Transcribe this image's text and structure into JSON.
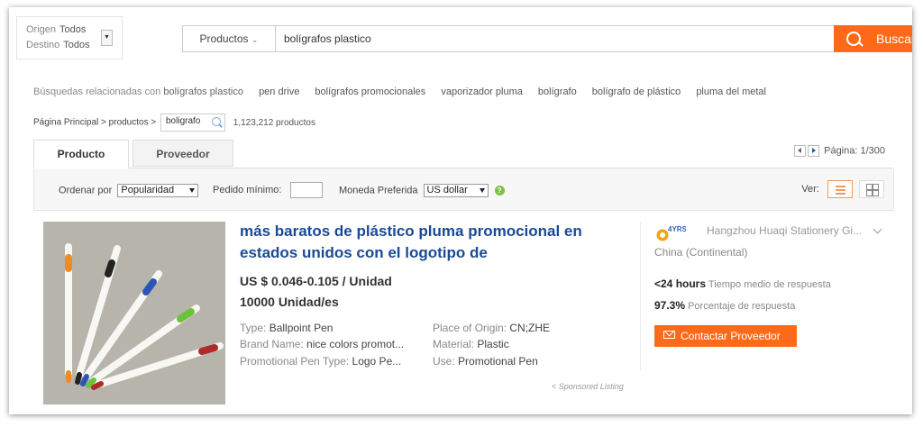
{
  "route": {
    "origin_label": "Origen",
    "origin_value": "Todos",
    "dest_label": "Destino",
    "dest_value": "Todos"
  },
  "search": {
    "category": "Productos",
    "query": "bolígrafos plastico",
    "button_label": "Buscar"
  },
  "related": {
    "prefix": "Búsquedas relacionadas con",
    "term": "bolígrafos plastico",
    "keywords": [
      "pen drive",
      "bolígrafos promocionales",
      "vaporizador pluma",
      "bolígrafo",
      "bolígrafo de plástico",
      "pluma del metal"
    ]
  },
  "breadcrumb": {
    "home": "Página Principal",
    "sep": ">",
    "category": "productos",
    "current": "boligrafo",
    "count": "1,123,212 productos"
  },
  "tabs": {
    "product": "Producto",
    "supplier": "Proveedor"
  },
  "pager": {
    "label": "Página: 1/300"
  },
  "filters": {
    "sort_label": "Ordenar por",
    "sort_value": "Popularidad",
    "min_order_label": "Pedido mínimo:",
    "min_order_value": "",
    "currency_label": "Moneda Preferida",
    "currency_value": "US dollar",
    "help": "?",
    "view_label": "Ver:"
  },
  "product": {
    "title": "más baratos de plástico pluma promocional en estados unidos con el logotipo de",
    "price": "US $ 0.046-0.105 / Unidad",
    "moq": "10000 Unidad/es",
    "attributes": [
      {
        "label": "Type:",
        "value": "Ballpoint Pen"
      },
      {
        "label": "Brand Name:",
        "value": "nice colors promot..."
      },
      {
        "label": "Promotional Pen Type:",
        "value": "Logo Pe..."
      },
      {
        "label": "Place of Origin:",
        "value": "CN;ZHE"
      },
      {
        "label": "Material:",
        "value": "Plastic"
      },
      {
        "label": "Use:",
        "value": "Promotional Pen"
      }
    ],
    "sponsored": "< Sponsored Listing"
  },
  "supplier": {
    "badge_text": "4YRS",
    "name": "Hangzhou Huaqi Stationery Gi...",
    "country": "China (Continental)",
    "response_time_value": "<24 hours",
    "response_time_label": "Tiempo medio de respuesta",
    "response_rate_value": "97.3%",
    "response_rate_label": "Porcentaje de respuesta",
    "contact_label": "Contactar Proveedor"
  },
  "colors": {
    "accent": "#ff6a1a",
    "link": "#1a4a96",
    "help_green": "#7dc242"
  }
}
